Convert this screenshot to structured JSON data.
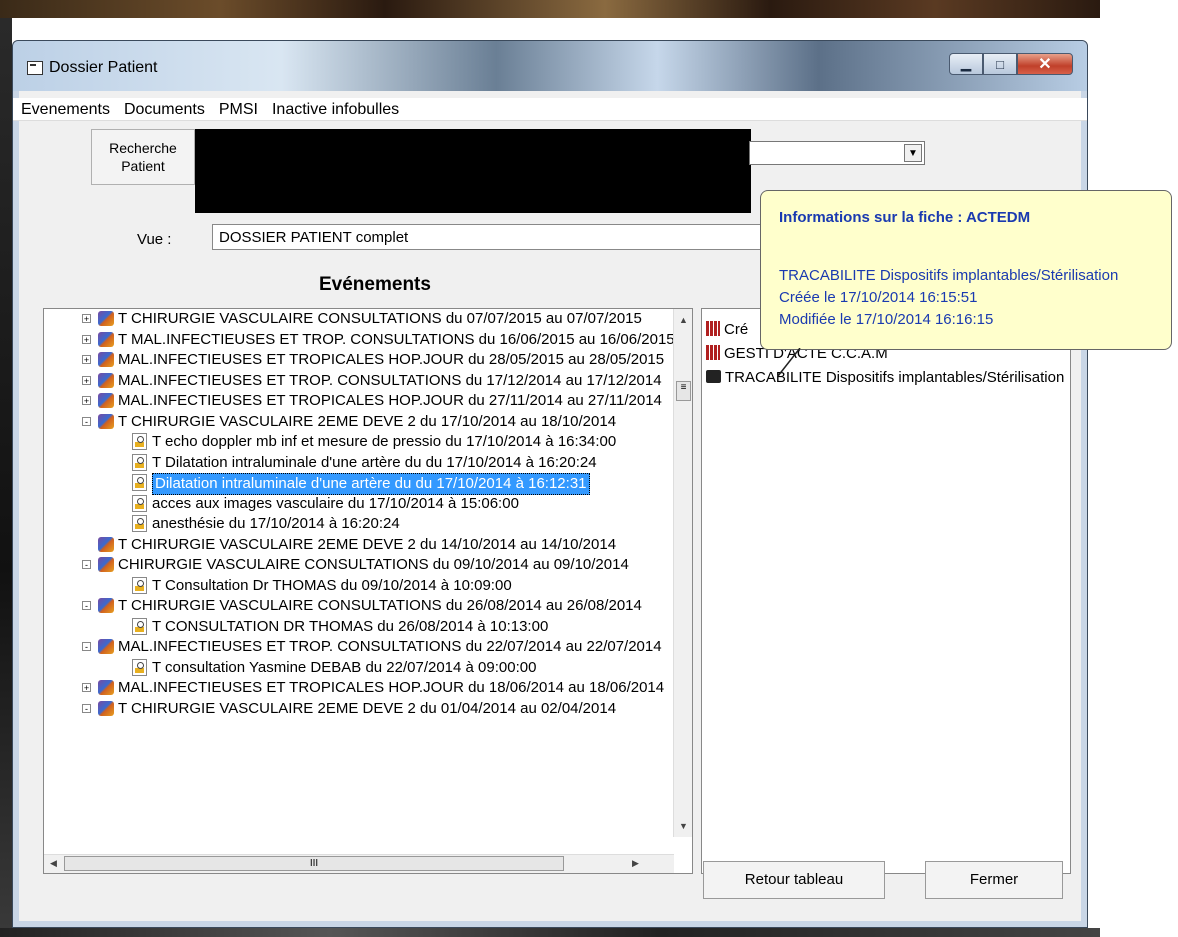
{
  "window": {
    "title": "Dossier Patient"
  },
  "menu": [
    "Evenements",
    "Documents",
    "PMSI",
    "Inactive infobulles"
  ],
  "search": {
    "button_label_1": "Recherche",
    "button_label_2": "Patient"
  },
  "vue": {
    "label": "Vue :",
    "value": "DOSSIER  PATIENT complet"
  },
  "events_heading": "Evénements",
  "tree_rows": [
    {
      "expander": "+",
      "icon": "book",
      "indent": 0,
      "text": "T  CHIRURGIE VASCULAIRE CONSULTATIONS du 07/07/2015 au 07/07/2015"
    },
    {
      "expander": "+",
      "icon": "book",
      "indent": 0,
      "text": "T  MAL.INFECTIEUSES ET TROP. CONSULTATIONS du 16/06/2015 au 16/06/2015"
    },
    {
      "expander": "+",
      "icon": "book",
      "indent": 0,
      "text": "MAL.INFECTIEUSES ET TROPICALES HOP.JOUR du 28/05/2015 au 28/05/2015"
    },
    {
      "expander": "+",
      "icon": "book",
      "indent": 0,
      "text": "MAL.INFECTIEUSES ET TROP. CONSULTATIONS du 17/12/2014 au 17/12/2014"
    },
    {
      "expander": "+",
      "icon": "book",
      "indent": 0,
      "text": "MAL.INFECTIEUSES ET TROPICALES HOP.JOUR du 27/11/2014 au 27/11/2014"
    },
    {
      "expander": "-",
      "icon": "book",
      "indent": 0,
      "text": "T  CHIRURGIE VASCULAIRE 2EME DEVE 2 du 17/10/2014 au 18/10/2014"
    },
    {
      "expander": "",
      "icon": "doc",
      "indent": 1,
      "text": "T  echo doppler mb inf et mesure de pressio du 17/10/2014  à  16:34:00"
    },
    {
      "expander": "",
      "icon": "doc",
      "indent": 1,
      "text": "T  Dilatation intraluminale d'une artère du du 17/10/2014  à  16:20:24"
    },
    {
      "expander": "",
      "icon": "doc",
      "indent": 1,
      "text": "Dilatation intraluminale d'une artère du du 17/10/2014  à  16:12:31",
      "selected": true
    },
    {
      "expander": "",
      "icon": "doc",
      "indent": 1,
      "text": "acces aux images vasculaire du 17/10/2014  à  15:06:00"
    },
    {
      "expander": "",
      "icon": "doc",
      "indent": 1,
      "text": "anesthésie du 17/10/2014  à  16:20:24"
    },
    {
      "expander": "",
      "icon": "book",
      "indent": 0,
      "text": "T  CHIRURGIE VASCULAIRE 2EME DEVE 2 du 14/10/2014 au 14/10/2014"
    },
    {
      "expander": "-",
      "icon": "book",
      "indent": 0,
      "text": "CHIRURGIE VASCULAIRE CONSULTATIONS du 09/10/2014 au 09/10/2014"
    },
    {
      "expander": "",
      "icon": "doc",
      "indent": 1,
      "text": "T  Consultation Dr THOMAS du 09/10/2014  à  10:09:00"
    },
    {
      "expander": "-",
      "icon": "book",
      "indent": 0,
      "text": "T  CHIRURGIE VASCULAIRE CONSULTATIONS du 26/08/2014 au 26/08/2014"
    },
    {
      "expander": "",
      "icon": "doc",
      "indent": 1,
      "text": "T  CONSULTATION DR THOMAS du 26/08/2014  à  10:13:00"
    },
    {
      "expander": "-",
      "icon": "book",
      "indent": 0,
      "text": "MAL.INFECTIEUSES ET TROP. CONSULTATIONS du 22/07/2014 au 22/07/2014"
    },
    {
      "expander": "",
      "icon": "doc",
      "indent": 1,
      "text": "T  consultation Yasmine DEBAB  du 22/07/2014  à  09:00:00"
    },
    {
      "expander": "+",
      "icon": "book",
      "indent": 0,
      "text": "MAL.INFECTIEUSES ET TROPICALES HOP.JOUR du 18/06/2014 au 18/06/2014"
    },
    {
      "expander": "-",
      "icon": "book",
      "indent": 0,
      "text": "T  CHIRURGIE VASCULAIRE 2EME DEVE 2 du 01/04/2014 au 02/04/2014"
    }
  ],
  "hscroll_label": "III",
  "right_docs": [
    {
      "icon": "red",
      "text": "Cré"
    },
    {
      "icon": "red",
      "text": "GESTI     D'ACTE C.C.A.M"
    },
    {
      "icon": "print",
      "text": "TRACABILITE Dispositifs implantables/Stérilisation"
    }
  ],
  "tooltip": {
    "title": "Informations sur la fiche : ACTEDM",
    "line1": "TRACABILITE Dispositifs implantables/Stérilisation",
    "line2": "Créée le 17/10/2014 16:15:51",
    "line3": "Modifiée le 17/10/2014 16:16:15"
  },
  "buttons": {
    "retour": "Retour tableau",
    "fermer": "Fermer"
  },
  "colors": {
    "selection": "#3399ff",
    "tooltip_bg": "#ffffcc",
    "tooltip_text": "#1a3ab0"
  }
}
